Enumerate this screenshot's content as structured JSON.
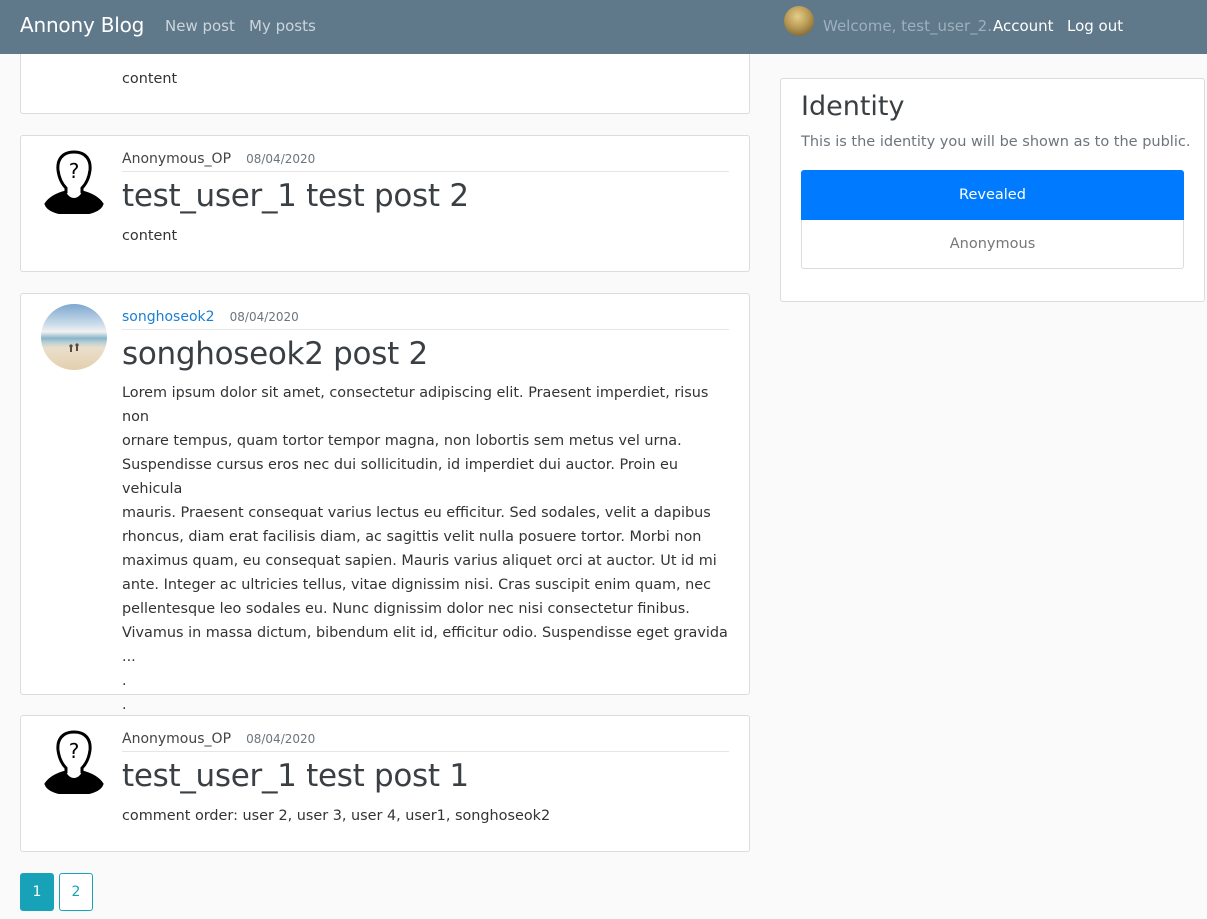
{
  "navbar": {
    "brand": "Annony Blog",
    "new_post": "New post",
    "my_posts": "My posts",
    "welcome": "Welcome, test_user_2.",
    "account": "Account",
    "logout": "Log out"
  },
  "posts": [
    {
      "partial": true,
      "content": "content"
    },
    {
      "author": "Anonymous_OP",
      "date": "08/04/2020",
      "title": "test_user_1 test post 2",
      "content": "content"
    },
    {
      "author": "songhoseok2",
      "date": "08/04/2020",
      "title": "songhoseok2 post 2",
      "content_lines": [
        "Lorem ipsum dolor sit amet, consectetur adipiscing elit. Praesent imperdiet, risus non",
        "ornare tempus, quam tortor tempor magna, non lobortis sem metus vel urna.",
        "Suspendisse cursus eros nec dui sollicitudin, id imperdiet dui auctor. Proin eu vehicula",
        "mauris. Praesent consequat varius lectus eu efficitur. Sed sodales, velit a dapibus",
        "rhoncus, diam erat facilisis diam, ac sagittis velit nulla posuere tortor. Morbi non",
        "maximus quam, eu consequat sapien. Mauris varius aliquet orci at auctor. Ut id mi",
        "ante. Integer ac ultricies tellus, vitae dignissim nisi. Cras suscipit enim quam, nec",
        "pellentesque leo sodales eu. Nunc dignissim dolor nec nisi consectetur finibus.",
        "Vivamus in massa dictum, bibendum elit id, efficitur odio. Suspendisse eget gravida ...",
        ".",
        ".",
        "."
      ]
    },
    {
      "author": "Anonymous_OP",
      "date": "08/04/2020",
      "title": "test_user_1 test post 1",
      "content": "comment order: user 2, user 3, user 4, user1, songhoseok2"
    }
  ],
  "pagination": {
    "pages": [
      "1",
      "2"
    ],
    "current": "1"
  },
  "identity": {
    "title": "Identity",
    "description": "This is the identity you will be shown as to the public.",
    "revealed": "Revealed",
    "anonymous": "Anonymous"
  },
  "colors": {
    "navbar": "#5f788a",
    "primary": "#007bff",
    "pagination": "#17a2b8",
    "link": "#1a7fd4"
  }
}
